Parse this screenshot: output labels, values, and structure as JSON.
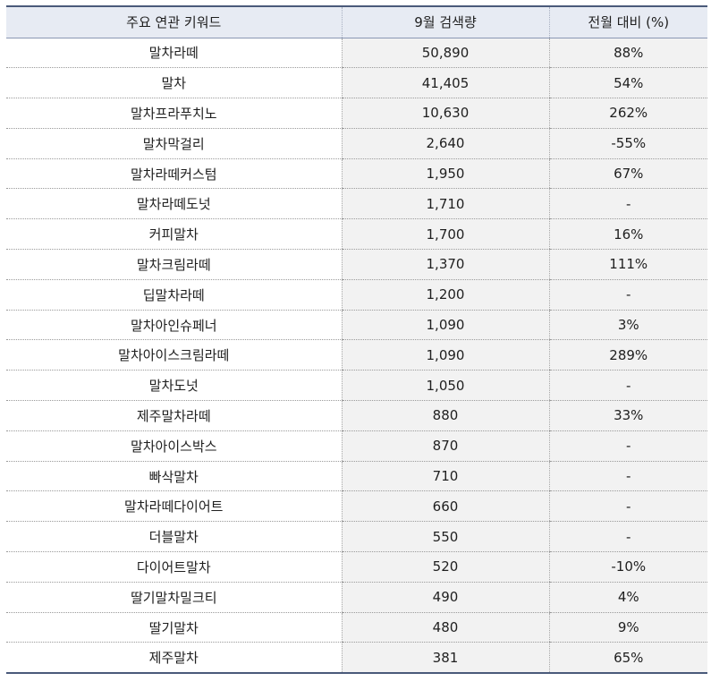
{
  "table": {
    "headers": [
      "주요 연관 키워드",
      "9월 검색량",
      "전월 대비 (%)"
    ],
    "rows": [
      [
        "말차라떼",
        "50,890",
        "88%"
      ],
      [
        "말차",
        "41,405",
        "54%"
      ],
      [
        "말차프라푸치노",
        "10,630",
        "262%"
      ],
      [
        "말차막걸리",
        "2,640",
        "-55%"
      ],
      [
        "말차라떼커스텀",
        "1,950",
        "67%"
      ],
      [
        "말차라떼도넛",
        "1,710",
        "-"
      ],
      [
        "커피말차",
        "1,700",
        "16%"
      ],
      [
        "말차크림라떼",
        "1,370",
        "111%"
      ],
      [
        "딥말차라떼",
        "1,200",
        "-"
      ],
      [
        "말차아인슈페너",
        "1,090",
        "3%"
      ],
      [
        "말차아이스크림라떼",
        "1,090",
        "289%"
      ],
      [
        "말차도넛",
        "1,050",
        "-"
      ],
      [
        "제주말차라떼",
        "880",
        "33%"
      ],
      [
        "말차아이스박스",
        "870",
        "-"
      ],
      [
        "빠삭말차",
        "710",
        "-"
      ],
      [
        "말차라떼다이어트",
        "660",
        "-"
      ],
      [
        "더블말차",
        "550",
        "-"
      ],
      [
        "다이어트말차",
        "520",
        "-10%"
      ],
      [
        "딸기말차밀크티",
        "490",
        "4%"
      ],
      [
        "딸기말차",
        "480",
        "9%"
      ],
      [
        "제주말차",
        "381",
        "65%"
      ]
    ]
  }
}
